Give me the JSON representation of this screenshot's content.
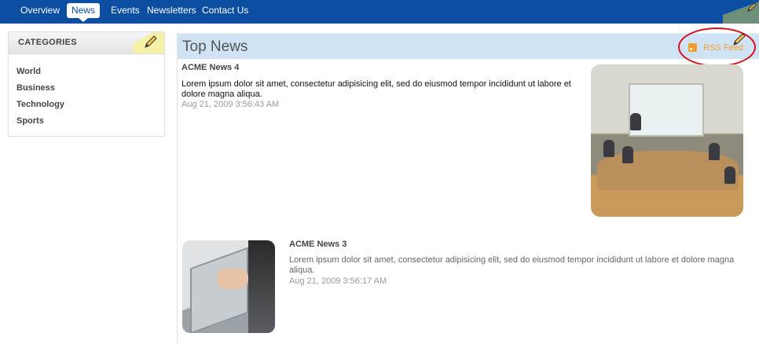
{
  "nav": {
    "items": [
      {
        "label": "Overview"
      },
      {
        "label": "News",
        "active": true
      },
      {
        "label": "Events"
      },
      {
        "label": "Newsletters"
      },
      {
        "label": "Contact Us"
      }
    ]
  },
  "categories": {
    "title": "CATEGORIES",
    "items": [
      {
        "label": "World"
      },
      {
        "label": "Business"
      },
      {
        "label": "Technology"
      },
      {
        "label": "Sports"
      }
    ]
  },
  "news": {
    "title": "Top News",
    "rss_label": "RSS Feed",
    "articles": [
      {
        "title": "ACME News 4",
        "body": "Lorem ipsum dolor sit amet, consectetur adipisicing elit, sed do eiusmod tempor incididunt ut labore et dolore magna aliqua.",
        "date": "Aug 21, 2009 3:56:43 AM"
      },
      {
        "title": "ACME News 3",
        "body": "Lorem ipsum dolor sit amet, consectetur adipisicing elit, sed do eiusmod tempor incididunt ut labore et dolore magna aliqua.",
        "date": "Aug 21, 2009 3:56:17 AM"
      }
    ]
  },
  "colors": {
    "nav_bg": "#0b4ea2",
    "header_bg": "#cfe3f5",
    "rss": "#f0a030",
    "highlight": "#d5101f"
  },
  "icons": [
    "pencil-icon",
    "rss-icon"
  ]
}
